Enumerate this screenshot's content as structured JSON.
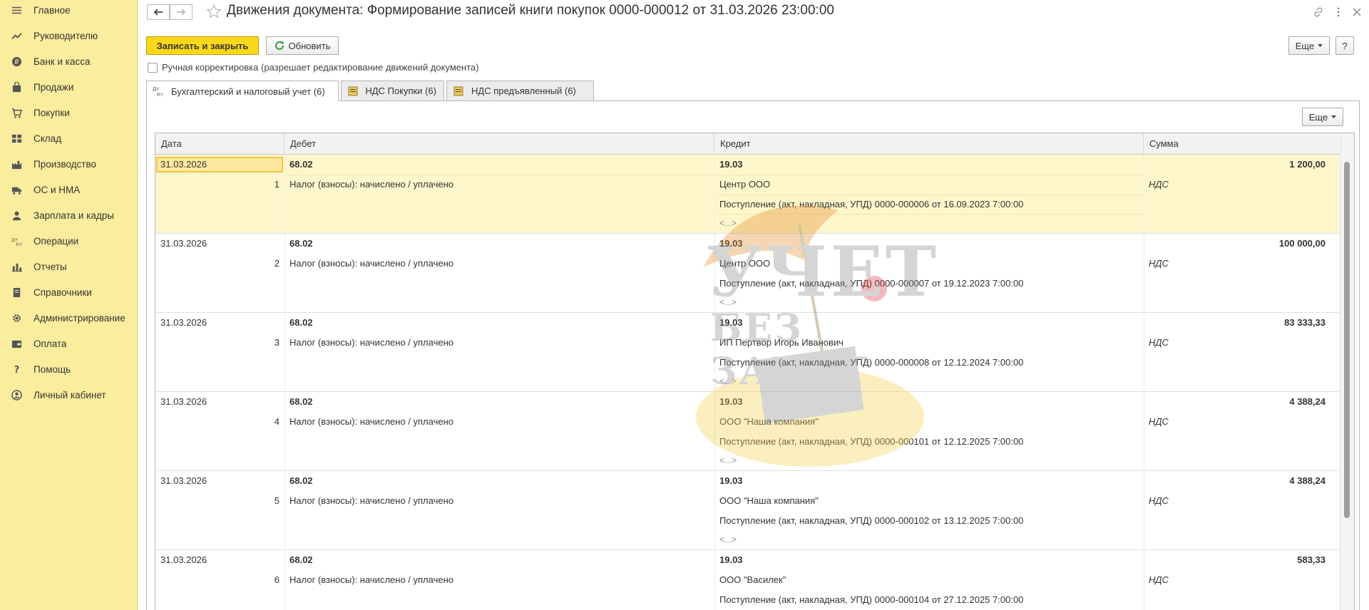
{
  "sidebar": {
    "items": [
      {
        "label": "Главное",
        "icon": "menu-icon"
      },
      {
        "label": "Руководителю",
        "icon": "trend-icon"
      },
      {
        "label": "Банк и касса",
        "icon": "coin-icon"
      },
      {
        "label": "Продажи",
        "icon": "bag-icon"
      },
      {
        "label": "Покупки",
        "icon": "cart-icon"
      },
      {
        "label": "Склад",
        "icon": "warehouse-icon"
      },
      {
        "label": "Производство",
        "icon": "factory-icon"
      },
      {
        "label": "ОС и НМА",
        "icon": "truck-icon"
      },
      {
        "label": "Зарплата и кадры",
        "icon": "person-icon"
      },
      {
        "label": "Операции",
        "icon": "dt-kt-icon"
      },
      {
        "label": "Отчеты",
        "icon": "bar-chart-icon"
      },
      {
        "label": "Справочники",
        "icon": "book-icon"
      },
      {
        "label": "Администрирование",
        "icon": "gear-icon"
      },
      {
        "label": "Оплата",
        "icon": "wallet-icon"
      },
      {
        "label": "Помощь",
        "icon": "question-icon"
      },
      {
        "label": "Личный кабинет",
        "icon": "account-icon"
      }
    ]
  },
  "header": {
    "title": "Движения документа: Формирование записей книги покупок 0000-000012 от 31.03.2026 23:00:00"
  },
  "toolbar": {
    "save_close": "Записать и закрыть",
    "refresh": "Обновить",
    "more": "Еще",
    "help": "?"
  },
  "manual_edit": {
    "label": "Ручная корректировка (разрешает редактирование движений документа)",
    "checked": false
  },
  "tabs": [
    {
      "label": "Бухгалтерский и налоговый учет (6)",
      "active": true
    },
    {
      "label": "НДС Покупки (6)",
      "active": false
    },
    {
      "label": "НДС предъявленный (6)",
      "active": false
    }
  ],
  "panel": {
    "more": "Еще"
  },
  "table": {
    "headers": [
      "Дата",
      "Дебет",
      "Кредит",
      "Сумма"
    ],
    "rows": [
      {
        "date": "31.03.2026",
        "num": "1",
        "debit_account": "68.02",
        "debit_subconto": "Налог (взносы): начислено / уплачено",
        "credit_account": "19.03",
        "credit_subconto1": "Центр ООО",
        "credit_subconto2": "Поступление (акт, накладная, УПД) 0000-000006 от 16.09.2023 7:00:00",
        "credit_subconto3": "<...>",
        "amount": "1 200,00",
        "amount_note": "НДС"
      },
      {
        "date": "31.03.2026",
        "num": "2",
        "debit_account": "68.02",
        "debit_subconto": "Налог (взносы): начислено / уплачено",
        "credit_account": "19.03",
        "credit_subconto1": "Центр ООО",
        "credit_subconto2": "Поступление (акт, накладная, УПД) 0000-000007 от 19.12.2023 7:00:00",
        "credit_subconto3": "<...>",
        "amount": "100 000,00",
        "amount_note": "НДС"
      },
      {
        "date": "31.03.2026",
        "num": "3",
        "debit_account": "68.02",
        "debit_subconto": "Налог (взносы): начислено / уплачено",
        "credit_account": "19.03",
        "credit_subconto1": "ИП Пертвор Игорь Иванович",
        "credit_subconto2": "Поступление (акт, накладная, УПД) 0000-000008 от 12.12.2024 7:00:00",
        "credit_subconto3": "<...>",
        "amount": "83 333,33",
        "amount_note": "НДС"
      },
      {
        "date": "31.03.2026",
        "num": "4",
        "debit_account": "68.02",
        "debit_subconto": "Налог (взносы): начислено / уплачено",
        "credit_account": "19.03",
        "credit_subconto1": "ООО \"Наша компания\"",
        "credit_subconto2": "Поступление (акт, накладная, УПД) 0000-000101 от 12.12.2025 7:00:00",
        "credit_subconto3": "<...>",
        "amount": "4 388,24",
        "amount_note": "НДС"
      },
      {
        "date": "31.03.2026",
        "num": "5",
        "debit_account": "68.02",
        "debit_subconto": "Налог (взносы): начислено / уплачено",
        "credit_account": "19.03",
        "credit_subconto1": "ООО \"Наша компания\"",
        "credit_subconto2": "Поступление (акт, накладная, УПД) 0000-000102 от 13.12.2025 7:00:00",
        "credit_subconto3": "<...>",
        "amount": "4 388,24",
        "amount_note": "НДС"
      },
      {
        "date": "31.03.2026",
        "num": "6",
        "debit_account": "68.02",
        "debit_subconto": "Налог (взносы): начислено / уплачено",
        "credit_account": "19.03",
        "credit_subconto1": "ООО \"Василек\"",
        "credit_subconto2": "Поступление (акт, накладная, УПД) 0000-000104 от 27.12.2025 7:00:00",
        "credit_subconto3": "<...>",
        "amount": "583,33",
        "amount_note": "НДС"
      }
    ]
  },
  "watermark": {
    "line1": "УЧЕТ",
    "line2": "БЕЗ ЗАБОТ"
  },
  "colors": {
    "sidebar": "#fbed9e",
    "primary_button": "#fcd81a",
    "selected_row": "#fff7cc"
  }
}
